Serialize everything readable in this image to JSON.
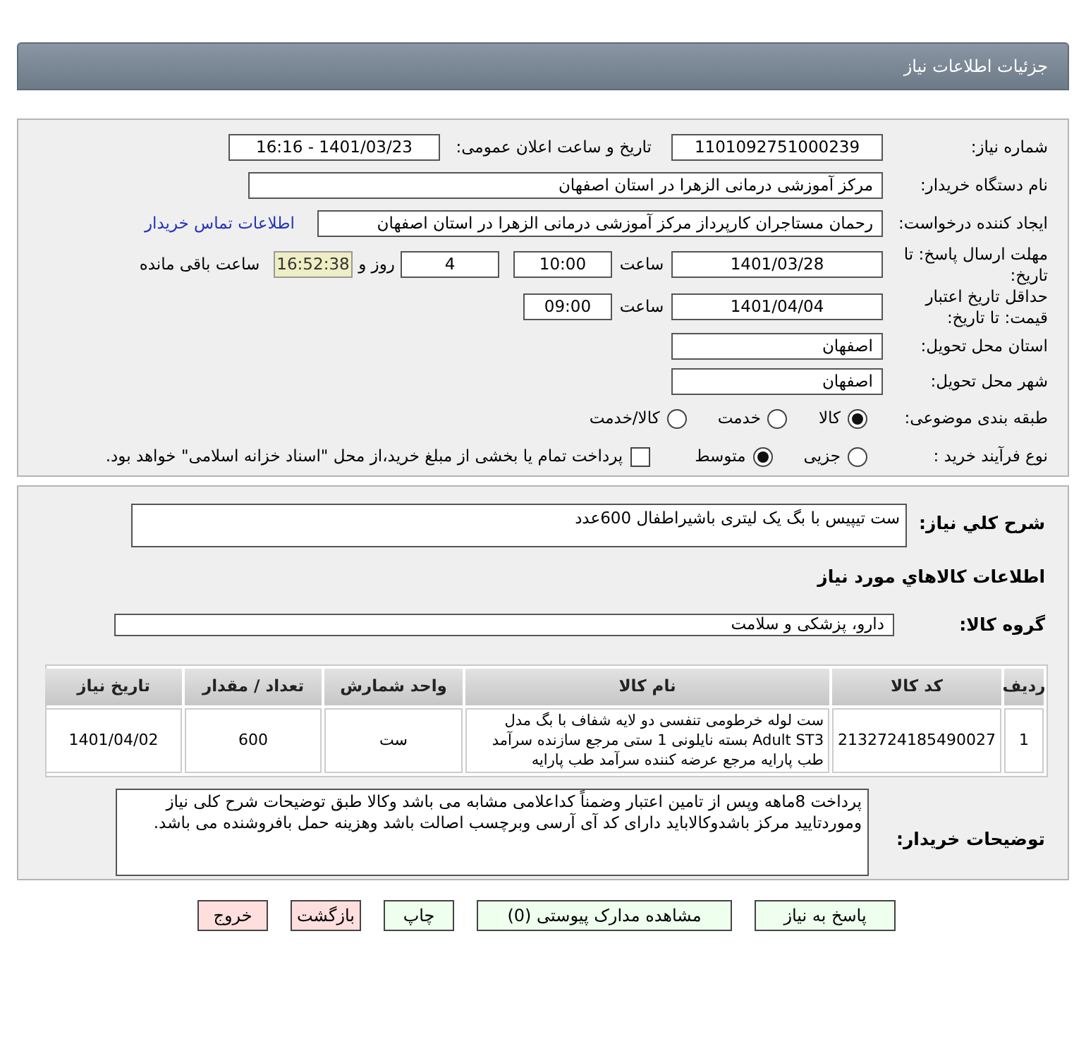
{
  "header": {
    "title": "جزئیات اطلاعات نیاز"
  },
  "need_number": {
    "label": "شماره نیاز:",
    "value": "1101092751000239"
  },
  "announce": {
    "label": "تاریخ و ساعت اعلان عمومی:",
    "value": "1401/03/23 - 16:16"
  },
  "buyer_org": {
    "label": "نام دستگاه خریدار:",
    "value": "مرکز آموزشی درمانی الزهرا در استان اصفهان"
  },
  "requester": {
    "label": "ایجاد کننده درخواست:",
    "value": "رحمان مستاجران کارپرداز مرکز آموزشی درمانی الزهرا در استان اصفهان",
    "link": "اطلاعات تماس خریدار"
  },
  "reply_deadline": {
    "label": "مهلت ارسال پاسخ: تا تاریخ:",
    "date": "1401/03/28",
    "time_label": "ساعت",
    "time": "10:00",
    "days": "4",
    "days_label": "روز و",
    "remaining": "16:52:38",
    "remaining_label": "ساعت باقی مانده"
  },
  "price_validity": {
    "label": "حداقل تاریخ اعتبار قیمت: تا تاریخ:",
    "date": "1401/04/04",
    "time_label": "ساعت",
    "time": "09:00"
  },
  "province": {
    "label": "استان محل تحویل:",
    "value": "اصفهان"
  },
  "city": {
    "label": "شهر محل تحویل:",
    "value": "اصفهان"
  },
  "category": {
    "label": "طبقه بندی موضوعی:",
    "options": [
      {
        "label": "کالا",
        "selected": true
      },
      {
        "label": "خدمت",
        "selected": false
      },
      {
        "label": "کالا/خدمت",
        "selected": false
      }
    ]
  },
  "process": {
    "label": "نوع فرآیند خرید :",
    "options": [
      {
        "label": "جزیی",
        "selected": false
      },
      {
        "label": "متوسط",
        "selected": true
      }
    ],
    "payment": {
      "label": "پرداخت تمام یا بخشی از مبلغ خرید،از محل \"اسناد خزانه اسلامی\" خواهد بود.",
      "checked": false
    }
  },
  "summary": {
    "label": "شرح كلي نياز:",
    "value": "ست تیپیس با بگ یک لیتری باشیراطفال 600عدد"
  },
  "goods_heading": "اطلاعات كالاهاي مورد نياز",
  "goods_group": {
    "label": "گروه كالا:",
    "value": "دارو، پزشکی و سلامت"
  },
  "table": {
    "columns": [
      "ردیف",
      "کد کالا",
      "نام کالا",
      "واحد شمارش",
      "تعداد / مقدار",
      "تاریخ نیاز"
    ],
    "rows": [
      {
        "cells": [
          "1",
          "2132724185490027",
          "ست لوله خرطومی تنفسی دو لایه شفاف با بگ مدل Adult ST3 بسته نایلونی 1 ستی مرجع سازنده سرآمد طب پارایه مرجع عرضه کننده سرآمد طب پارایه",
          "ست",
          "600",
          "1401/04/02"
        ]
      }
    ]
  },
  "buyer_notes": {
    "label": "توضیحات خریدار:",
    "value": "پرداخت 8ماهه وپس از تامین اعتبار وضمناً کداعلامی مشابه می باشد وکالا طبق توضیحات شرح کلی نیاز وموردتایید مرکز باشدوکالاباید دارای کد آی آرسی وبرچسب اصالت باشد وهزینه حمل بافروشنده می باشد."
  },
  "buttons": [
    {
      "label": "پاسخ به نیاز",
      "kind": "action"
    },
    {
      "label": "مشاهده مدارک پیوستی (0)",
      "kind": "action"
    },
    {
      "label": "چاپ",
      "kind": "action"
    },
    {
      "label": "بازگشت",
      "kind": "exit"
    },
    {
      "label": "خروج",
      "kind": "exit"
    }
  ]
}
